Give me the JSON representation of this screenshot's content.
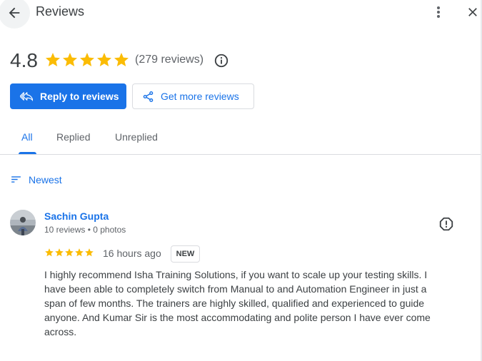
{
  "header": {
    "title": "Reviews",
    "back_icon": "arrow-back-icon",
    "more_icon": "more-vert-icon",
    "close_icon": "close-icon"
  },
  "summary": {
    "rating": "4.8",
    "stars": 5,
    "review_count": "(279 reviews)",
    "info_icon": "info-icon",
    "star_color": "#fbbc04"
  },
  "actions": {
    "reply_label": "Reply to reviews",
    "reply_icon": "reply-all-icon",
    "get_more_label": "Get more reviews",
    "get_more_icon": "share-icon"
  },
  "tabs": [
    {
      "label": "All",
      "active": true
    },
    {
      "label": "Replied",
      "active": false
    },
    {
      "label": "Unreplied",
      "active": false
    }
  ],
  "sort": {
    "label": "Newest",
    "icon": "sort-icon"
  },
  "review": {
    "name": "Sachin Gupta",
    "meta": "10 reviews • 0 photos",
    "stars": 5,
    "time": "16 hours ago",
    "badge": "NEW",
    "text": "I highly recommend Isha Training Solutions, if you want to scale up your testing skills. I have been able to completely switch from Manual to and Automation Engineer in just a span of few months. The trainers are highly skilled, qualified and experienced to guide anyone. And Kumar Sir is the most accommodating and polite person I have ever come across.",
    "report_icon": "report-icon"
  },
  "colors": {
    "accent": "#1a73e8",
    "star": "#fbbc04",
    "divider": "#dadce0"
  }
}
